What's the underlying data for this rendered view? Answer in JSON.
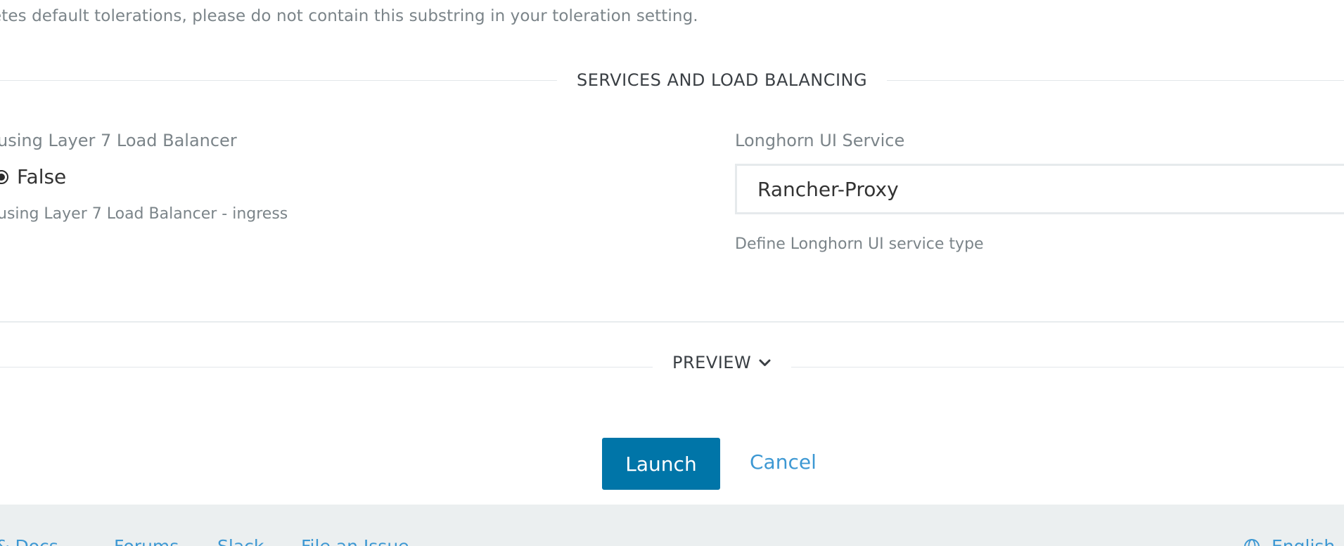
{
  "top_note": "etes default tolerations, please do not contain this substring in your toleration setting.",
  "services_section": {
    "title": "SERVICES AND LOAD BALANCING",
    "left_field": {
      "label": "using Layer 7 Load Balancer",
      "selected_option": "False",
      "help": "using Layer 7 Load Balancer - ingress"
    },
    "right_field": {
      "label": "Longhorn UI Service",
      "value": "Rancher-Proxy",
      "help": "Define Longhorn UI service type"
    }
  },
  "preview": {
    "label": "PREVIEW",
    "icon": "chevron-down-icon"
  },
  "actions": {
    "launch_label": "Launch",
    "cancel_label": "Cancel"
  },
  "footer": {
    "links": [
      "& Docs",
      "Forums",
      "Slack",
      "File an Issue"
    ],
    "language_icon": "globe-icon",
    "language": "English"
  },
  "colors": {
    "primary": "#0075a8",
    "link": "#3d98d3",
    "muted_text": "#7b8489",
    "footer_bg": "#ebeff0"
  }
}
